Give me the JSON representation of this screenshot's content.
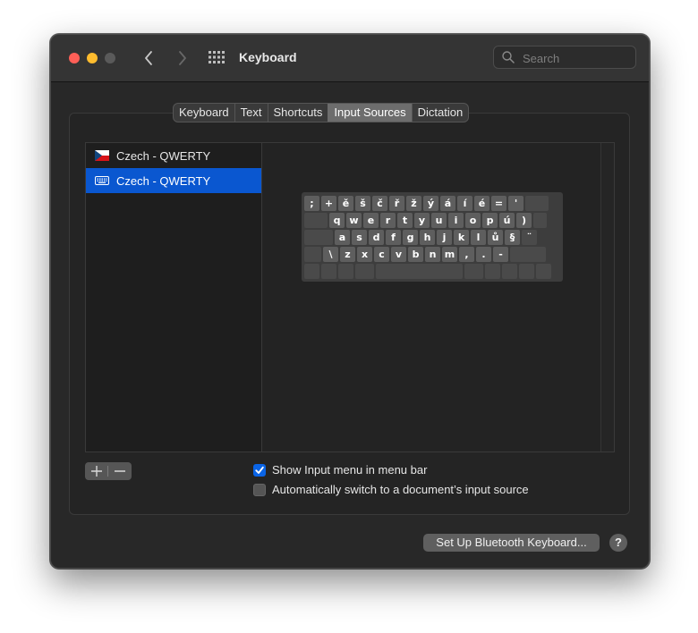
{
  "window": {
    "title": "Keyboard",
    "search_placeholder": "Search"
  },
  "tabs": [
    {
      "label": "Keyboard",
      "active": false
    },
    {
      "label": "Text",
      "active": false
    },
    {
      "label": "Shortcuts",
      "active": false
    },
    {
      "label": "Input Sources",
      "active": true
    },
    {
      "label": "Dictation",
      "active": false
    }
  ],
  "sources": [
    {
      "label": "Czech - QWERTY",
      "icon": "czech-flag-icon",
      "selected": false
    },
    {
      "label": "Czech - QWERTY",
      "icon": "keyboard-icon",
      "selected": true
    }
  ],
  "keyboard_layout": {
    "row1": [
      ";",
      "+",
      "ě",
      "š",
      "č",
      "ř",
      "ž",
      "ý",
      "á",
      "í",
      "é",
      "=",
      "'"
    ],
    "row2": [
      "q",
      "w",
      "e",
      "r",
      "t",
      "y",
      "u",
      "i",
      "o",
      "p",
      "ú",
      ")"
    ],
    "row3": [
      "a",
      "s",
      "d",
      "f",
      "g",
      "h",
      "j",
      "k",
      "l",
      "ů",
      "§",
      "¨"
    ],
    "row4": [
      "\\",
      "z",
      "x",
      "c",
      "v",
      "b",
      "n",
      "m",
      ",",
      ".",
      "-"
    ]
  },
  "buttons": {
    "add": "+",
    "remove": "−",
    "bluetooth": "Set Up Bluetooth Keyboard...",
    "help": "?"
  },
  "options": {
    "show_input_menu": {
      "label": "Show Input menu in menu bar",
      "checked": true
    },
    "auto_switch": {
      "label": "Automatically switch to a document’s input source",
      "checked": false
    }
  },
  "colors": {
    "selection": "#0a57d0",
    "checkbox_on": "#0a64e6",
    "close": "#fe5f57",
    "minimize": "#febc2e"
  }
}
